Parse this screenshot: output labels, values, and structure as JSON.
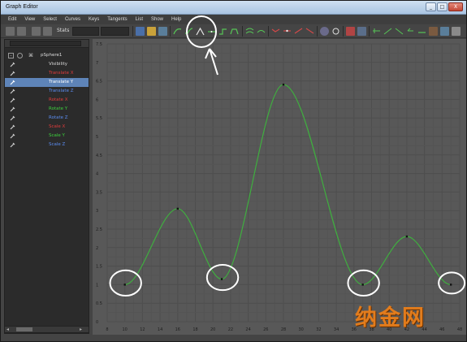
{
  "window": {
    "title": "Graph Editor",
    "controls": [
      "_",
      "□",
      "X"
    ]
  },
  "menubar": [
    "Edit",
    "View",
    "Select",
    "Curves",
    "Keys",
    "Tangents",
    "List",
    "Show",
    "Help"
  ],
  "toolbar": {
    "stats_label": "Stats"
  },
  "outliner": {
    "root": {
      "label": "pSphere1",
      "expand": "-"
    },
    "attributes": [
      {
        "label": "Visibility",
        "color": "#d8d8d8",
        "selected": false
      },
      {
        "label": "Translate X",
        "color": "#e03c3c",
        "selected": false
      },
      {
        "label": "Translate Y",
        "color": "#ffffff",
        "selected": true
      },
      {
        "label": "Translate Z",
        "color": "#5b8cf0",
        "selected": false
      },
      {
        "label": "Rotate X",
        "color": "#e03c3c",
        "selected": false
      },
      {
        "label": "Rotate Y",
        "color": "#3cd13c",
        "selected": false
      },
      {
        "label": "Rotate Z",
        "color": "#5b8cf0",
        "selected": false
      },
      {
        "label": "Scale X",
        "color": "#e03c3c",
        "selected": false
      },
      {
        "label": "Scale Y",
        "color": "#3cd13c",
        "selected": false
      },
      {
        "label": "Scale Z",
        "color": "#5b8cf0",
        "selected": false
      }
    ]
  },
  "graph": {
    "y_ticks": [
      "0",
      "0.5",
      "1",
      "1.5",
      "2",
      "2.5",
      "3",
      "3.5",
      "4",
      "4.5",
      "5",
      "5.5",
      "6",
      "6.5",
      "7",
      "7.5"
    ],
    "x_ticks": [
      "8",
      "10",
      "12",
      "14",
      "16",
      "18",
      "20",
      "22",
      "24",
      "26",
      "28",
      "30",
      "32",
      "34",
      "36",
      "38",
      "40",
      "42",
      "44",
      "46",
      "48"
    ],
    "keys": [
      {
        "frame": 10,
        "value": 1.0
      },
      {
        "frame": 16,
        "value": 3.05
      },
      {
        "frame": 21,
        "value": 1.15
      },
      {
        "frame": 28,
        "value": 6.4
      },
      {
        "frame": 37,
        "value": 1.0
      },
      {
        "frame": 42,
        "value": 2.3
      },
      {
        "frame": 47,
        "value": 1.0
      }
    ],
    "curve_color": "#3fae3f"
  },
  "watermark": "纳金网"
}
